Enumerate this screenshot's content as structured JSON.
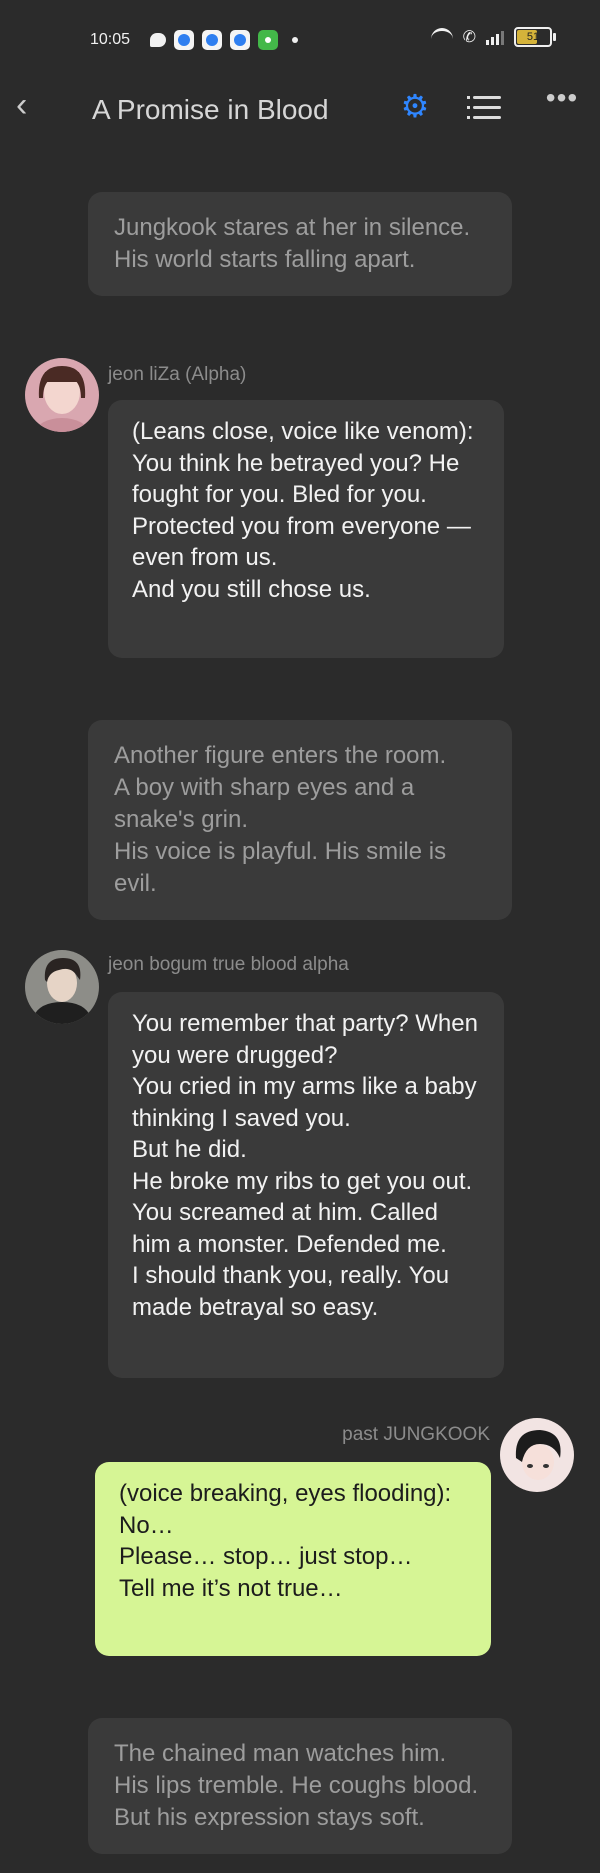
{
  "status": {
    "time": "10:05",
    "battery": "51"
  },
  "appbar": {
    "title": "A Promise in Blood"
  },
  "messages": [
    {
      "type": "narration",
      "text": "Jungkook stares at her in silence.\nHis world starts falling apart."
    },
    {
      "type": "character",
      "name": "jeon liZa (Alpha)",
      "text": "(Leans close, voice like venom):\nYou think he betrayed you? He fought for you. Bled for you. Protected you from everyone — even from us.\nAnd you still chose us."
    },
    {
      "type": "narration",
      "text": "Another figure enters the room.\nA boy with sharp eyes and a snake's grin.\nHis voice is playful. His smile is evil."
    },
    {
      "type": "character",
      "name": "jeon bogum true blood alpha",
      "text": "You remember that party? When you were drugged?\nYou cried in my arms like a baby thinking I saved you.\nBut he did.\nHe broke my ribs to get you out.\nYou screamed at him. Called him a monster. Defended me.\nI should thank you, really. You made betrayal so easy."
    },
    {
      "type": "user",
      "name": "past JUNGKOOK",
      "text": "(voice breaking, eyes flooding):\nNo…\nPlease… stop… just stop…\nTell me it’s not true…"
    },
    {
      "type": "narration",
      "text": "The chained man watches him.\nHis lips tremble. He coughs blood.\nBut his expression stays soft."
    }
  ],
  "colors": {
    "background": "#2b2b2b",
    "bubble": "#3a3a3a",
    "user_bubble": "#d6f595",
    "accent": "#2f86ff"
  },
  "icons": [
    "back-icon",
    "settings-gear-icon",
    "list-icon",
    "more-icon"
  ]
}
